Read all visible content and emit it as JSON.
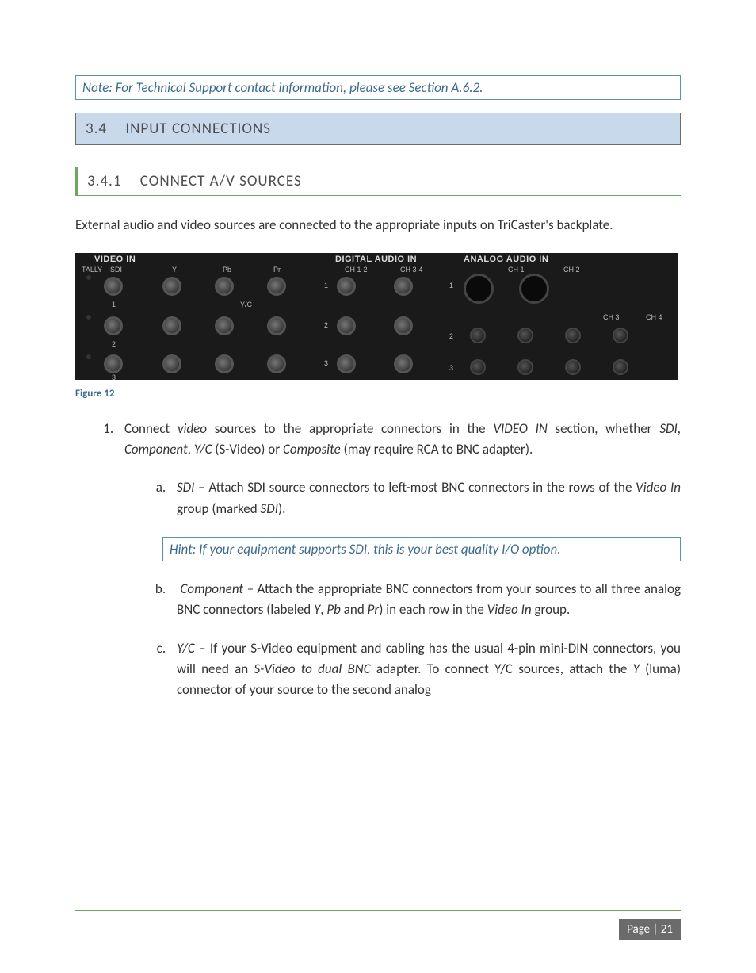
{
  "note": "Note: For Technical Support contact information, please see Section A.6.2.",
  "h2": {
    "num": "3.4",
    "title": "INPUT CONNECTIONS"
  },
  "h3": {
    "num": "3.4.1",
    "title": "CONNECT A/V SOURCES"
  },
  "intro": "External audio and video sources are connected to the appropriate inputs on TriCaster's backplate.",
  "figure": {
    "caption": "Figure 12",
    "labels": {
      "video_in": "VIDEO IN",
      "digital_audio_in": "DIGITAL AUDIO IN",
      "analog_audio_in": "ANALOG AUDIO IN",
      "tally": "TALLY",
      "sdi": "SDI",
      "y": "Y",
      "pb": "Pb",
      "pr": "Pr",
      "yc": "Y/C",
      "ch12": "CH 1-2",
      "ch34": "CH 3-4",
      "ch1": "CH 1",
      "ch2": "CH 2",
      "ch3": "CH 3",
      "ch4": "CH 4",
      "r1": "1",
      "r2": "2",
      "r3": "3"
    }
  },
  "list1": {
    "pre": "Connect ",
    "video": "video",
    "mid1": " sources to the appropriate connectors in the ",
    "videoin": "VIDEO IN",
    "mid2": " section, whether ",
    "sdi": "SDI",
    "comma1": ", ",
    "component": "Component",
    "comma2": ", ",
    "yc": "Y/C",
    "svideo": " (S-Video) or ",
    "composite": "Composite",
    "tail": " (may require RCA to BNC adapter)."
  },
  "subA": {
    "lead": "SDI",
    "dash": " –  Attach SDI source connectors to left-most BNC connectors in the rows of the ",
    "vi": "Video In",
    "mid": " group (marked ",
    "sdi2": "SDI",
    "tail": ")."
  },
  "hint": "Hint: If your equipment supports SDI, this is your best quality I/O option.",
  "subB": {
    "lead": "Component –",
    "t1": " Attach the appropriate BNC connectors from your sources to all three analog BNC connectors (labeled ",
    "y": "Y",
    "c1": ", ",
    "pb": "Pb",
    "c2": " and ",
    "pr": "Pr",
    "t2": ") in each row in the ",
    "vi": "Video In",
    "t3": " group."
  },
  "subC": {
    "lead": "Y/C",
    "t1": " –  If your S-Video equipment and cabling has the usual 4-pin mini-DIN connectors, you will need an ",
    "sv": "S-Video to dual BNC",
    "t2": " adapter.  To connect Y/C sources, attach the ",
    "y": "Y",
    "t3": " (luma) connector of your source to the second analog"
  },
  "page": "Page | 21"
}
